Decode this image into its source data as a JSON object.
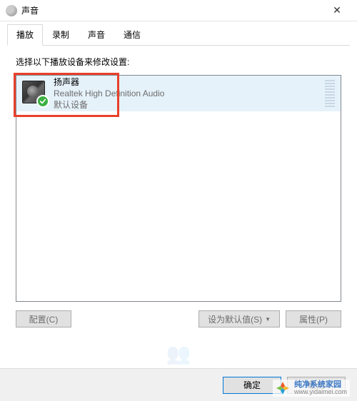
{
  "window": {
    "title": "声音",
    "close_label": "✕"
  },
  "tabs": [
    {
      "label": "播放",
      "active": true
    },
    {
      "label": "录制",
      "active": false
    },
    {
      "label": "声音",
      "active": false
    },
    {
      "label": "通信",
      "active": false
    }
  ],
  "content": {
    "instruction": "选择以下播放设备来修改设置:"
  },
  "devices": [
    {
      "name": "扬声器",
      "description": "Realtek High Definition Audio",
      "status": "默认设备",
      "default": true,
      "selected": true
    }
  ],
  "buttons": {
    "configure": "配置(C)",
    "set_default": "设为默认值(S)",
    "properties": "属性(P)"
  },
  "dialog_buttons": {
    "ok": "确定",
    "cancel": "取消"
  },
  "watermark": {
    "line1": "纯净系统家园",
    "line2": "www.yidaimei.com"
  }
}
